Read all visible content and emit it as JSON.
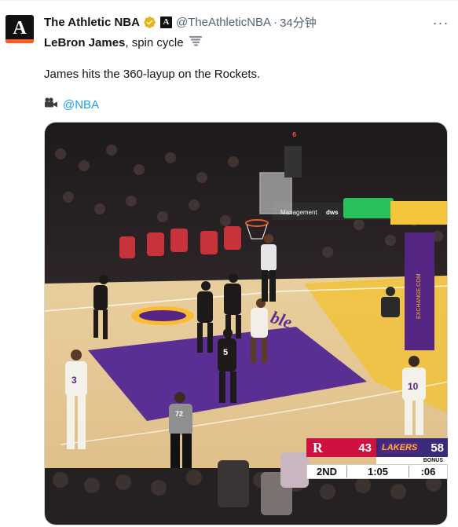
{
  "tweet": {
    "author_name": "The Athletic NBA",
    "author_handle": "@TheAthleticNBA",
    "separator": "·",
    "time": "34分钟",
    "avatar_letter": "A",
    "more_label": "···",
    "lead_bold": "LeBron James",
    "lead_rest": ", spin cycle",
    "body": "James hits the 360-layup on the Rockets.",
    "credit": "@NBA"
  },
  "scoreboard": {
    "home_logo": "R",
    "home_score": "43",
    "away_logo": "LAKERS",
    "away_score": "58",
    "bonus": "BONUS",
    "quarter": "2ND",
    "clock": "1:05",
    "shot_clock": ":06"
  },
  "court": {
    "ad_text": "ble",
    "sign_text": "Management",
    "sign_text2": "dws",
    "stanchion_text": "EXCHANGE.COM",
    "jersey_3": "3",
    "jersey_5": "5",
    "jersey_10": "10",
    "jersey_72": "72"
  },
  "colors": {
    "accent": "#1d9bf0",
    "verified": "#e7b417",
    "rockets_red": "#ce1141",
    "lakers_purple": "#552583",
    "lakers_gold": "#fdb927"
  }
}
